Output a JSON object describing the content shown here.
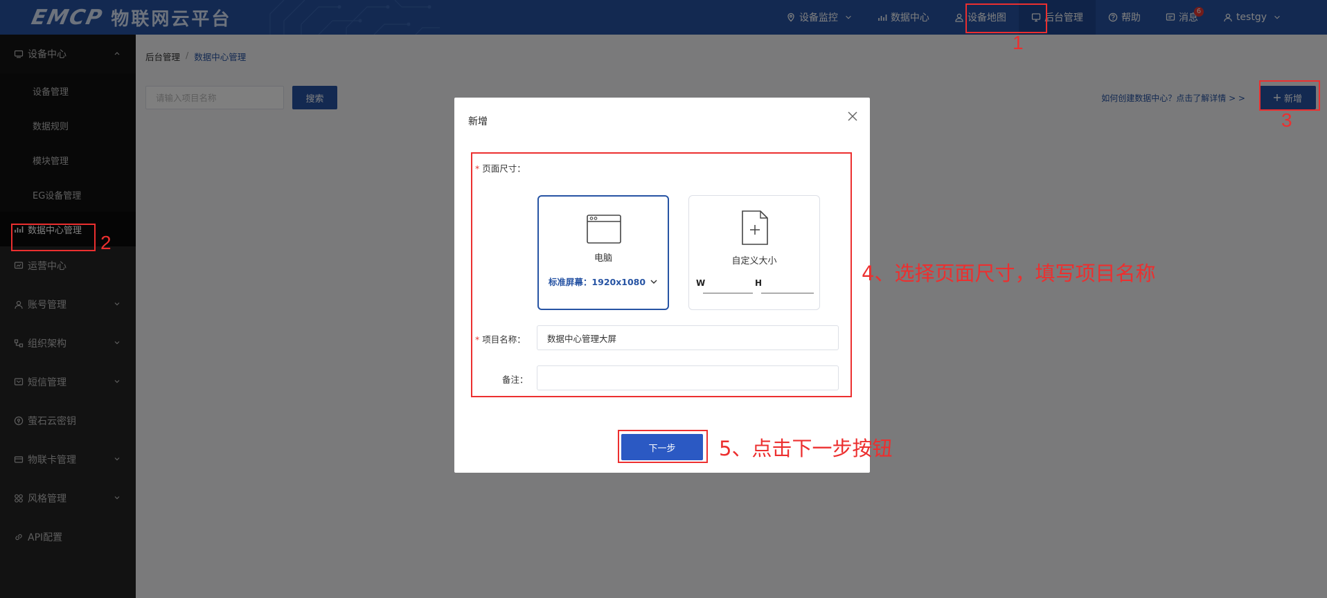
{
  "header": {
    "logo_mark": "EMCP",
    "logo_text": "物联网云平台",
    "nav": [
      {
        "label": "设备监控"
      },
      {
        "label": "数据中心"
      },
      {
        "label": "设备地图"
      },
      {
        "label": "后台管理"
      },
      {
        "label": "帮助"
      },
      {
        "label": "消息",
        "badge": "6"
      },
      {
        "label": "testgy"
      }
    ]
  },
  "sidebar": {
    "group_device": "设备中心",
    "sub_items": [
      "设备管理",
      "数据规则",
      "模块管理",
      "EG设备管理",
      "数据中心管理"
    ],
    "groups": [
      "运营中心",
      "账号管理",
      "组织架构",
      "短信管理",
      "萤石云密钥",
      "物联卡管理",
      "风格管理",
      "API配置"
    ]
  },
  "main": {
    "breadcrumb": [
      "后台管理",
      "/",
      "数据中心管理"
    ],
    "search_placeholder": "请输入项目名称",
    "search_button": "搜索",
    "help_link": "如何创建数据中心？点击了解详情 > >",
    "add_button": "新增"
  },
  "modal": {
    "title": "新增",
    "size_label": "页面尺寸：",
    "pc_card": {
      "title": "电脑",
      "resolution": "标准屏幕：1920x1080"
    },
    "custom_card": {
      "title": "自定义大小",
      "w_label": "W",
      "h_label": "H"
    },
    "name_label": "项目名称：",
    "name_value": "数据中心管理大屏",
    "remark_label": "备注：",
    "remark_value": "",
    "next_button": "下一步"
  },
  "annotations": {
    "n1": "1",
    "n2": "2",
    "n3": "3",
    "step4": "4、选择页面尺寸，填写项目名称",
    "step5": "5、点击下一步按钮"
  },
  "colors": {
    "primary": "#2653a3",
    "annotation": "#ec2f2f",
    "sidebar_bg": "#242424"
  }
}
